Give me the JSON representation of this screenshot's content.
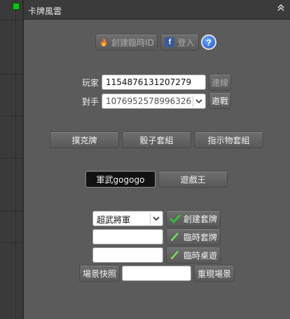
{
  "window": {
    "title": "卡牌風雲"
  },
  "top_buttons": {
    "create_temp_id_label": "創建臨時ID",
    "login_label": "登入",
    "help_glyph": "?"
  },
  "player_row": {
    "label": "玩家",
    "value": "1154876131207279",
    "connect_label": "連線"
  },
  "opponent_row": {
    "label": "對手",
    "value": "1076952578996326",
    "invite_label": "邀戰"
  },
  "game_type_buttons": [
    "撲克牌",
    "骰子套組",
    "指示物套組"
  ],
  "deck_buttons": {
    "selected": "軍武gogogo",
    "other": "遊戲王"
  },
  "deck_form": {
    "deck_select_value": "超武將軍",
    "create_deck_label": "創建套牌",
    "temp_deck_value": "",
    "temp_deck_label": "臨時套牌",
    "temp_table_value": "",
    "temp_table_label": "臨時桌遊",
    "snapshot_label": "場景快照",
    "snapshot_value": "",
    "restore_label": "重現場景"
  },
  "colors": {
    "green_indicator": "#16c01a",
    "check_green": "#38c23a"
  }
}
